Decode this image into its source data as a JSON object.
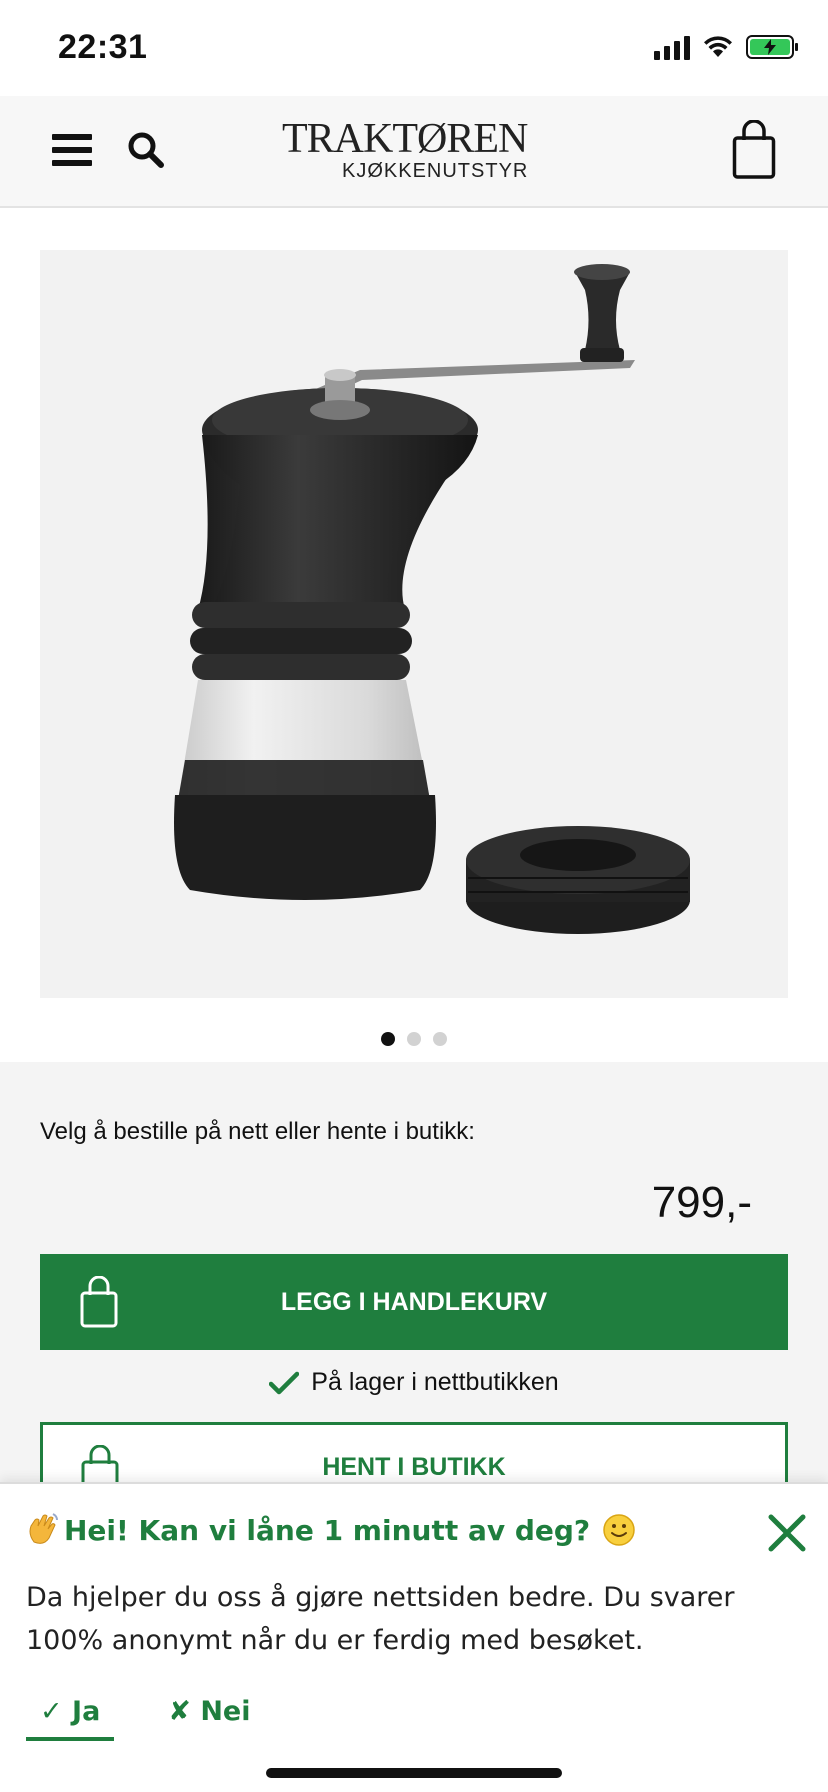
{
  "status_bar": {
    "time": "22:31"
  },
  "header": {
    "logo_main": "TRAKTØREN",
    "logo_sub": "KJØKKENUTSTYR"
  },
  "gallery": {
    "image_alt": "Hario Skerton kaffekvern",
    "pages": 3,
    "active_page": 1
  },
  "purchase": {
    "choose_text": "Velg å bestille på nett eller hente i butikk:",
    "price": "799,-",
    "add_to_cart_label": "LEGG I HANDLEKURV",
    "stock_text": "På lager i nettbutikken",
    "pickup_label": "HENT I BUTIKK"
  },
  "survey": {
    "title": "Hei! Kan vi låne 1 minutt av deg?",
    "body": "Da hjelper du oss å gjøre nettsiden bedre. Du svarer 100% anonymt når du er ferdig med besøket.",
    "yes_label": "✓ Ja",
    "no_label": "✘ Nei"
  },
  "colors": {
    "brand_green": "#1f7e3e",
    "battery_green": "#34c759"
  }
}
